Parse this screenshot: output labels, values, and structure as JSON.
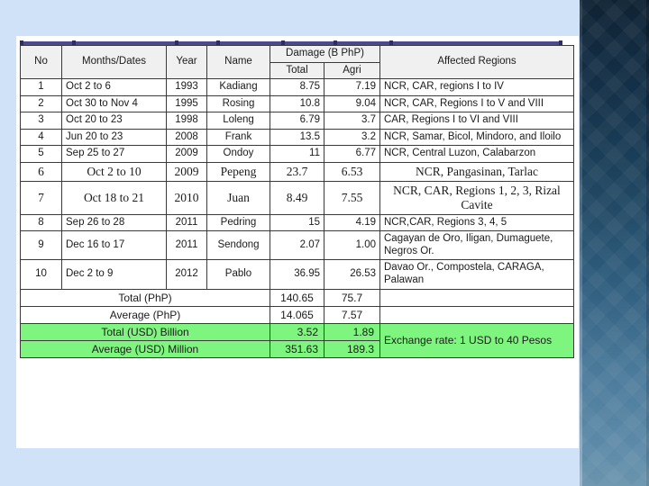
{
  "slide": {
    "background_color": "#cfe2f7",
    "panel_gradient_top": "#0f2233",
    "panel_gradient_bottom": "#6b94ad",
    "card_color": "#ffffff",
    "ruler_color": "#4a4a8c",
    "highlight_green": "#7ef57e"
  },
  "table": {
    "headers": {
      "no": "No",
      "months_dates": "Months/Dates",
      "year": "Year",
      "name": "Name",
      "damage_group": "Damage (B PhP)",
      "total": "Total",
      "agri": "Agri",
      "affected_regions": "Affected Regions"
    },
    "rows": [
      {
        "no": "1",
        "dates": "Oct 2 to 6",
        "year": "1993",
        "name": "Kadiang",
        "total": "8.75",
        "agri": "7.19",
        "regions": "NCR, CAR, regions I to IV",
        "style": "sans"
      },
      {
        "no": "2",
        "dates": "Oct 30 to Nov 4",
        "year": "1995",
        "name": "Rosing",
        "total": "10.8",
        "agri": "9.04",
        "regions": "NCR, CAR, Regions  I to V and VIII",
        "style": "sans"
      },
      {
        "no": "3",
        "dates": "Oct 20 to 23",
        "year": "1998",
        "name": "Loleng",
        "total": "6.79",
        "agri": "3.7",
        "regions": "CAR, Regions I to VI and VIII",
        "style": "sans"
      },
      {
        "no": "4",
        "dates": "Jun 20 to 23",
        "year": "2008",
        "name": "Frank",
        "total": "13.5",
        "agri": "3.2",
        "regions": "NCR, Samar, Bicol, Mindoro, and Iloilo",
        "style": "sans"
      },
      {
        "no": "5",
        "dates": "Sep 25 to 27",
        "year": "2009",
        "name": "Ondoy",
        "total": "11",
        "agri": "6.77",
        "regions": "NCR, Central Luzon, Calabarzon",
        "style": "sans"
      },
      {
        "no": "6",
        "dates": "Oct 2 to 10",
        "year": "2009",
        "name": "Pepeng",
        "total": "23.7",
        "agri": "6.53",
        "regions": "NCR, Pangasinan, Tarlac",
        "style": "serif"
      },
      {
        "no": "7",
        "dates": "Oct 18 to 21",
        "year": "2010",
        "name": "Juan",
        "total": "8.49",
        "agri": "7.55",
        "regions": "NCR, CAR, Regions 1, 2, 3, Rizal Cavite",
        "style": "serif"
      },
      {
        "no": "8",
        "dates": "Sep 26 to 28",
        "year": "2011",
        "name": "Pedring",
        "total": "15",
        "agri": "4.19",
        "regions": "NCR,CAR,  Regions 3, 4, 5",
        "style": "sans"
      },
      {
        "no": "9",
        "dates": "Dec 16 to 17",
        "year": "2011",
        "name": "Sendong",
        "total": "2.07",
        "agri": "1.00",
        "regions": "Cagayan de Oro, Iligan, Dumaguete, Negros Or.",
        "style": "sans"
      },
      {
        "no": "10",
        "dates": "Dec 2 to 9",
        "year": "2012",
        "name": "Pablo",
        "total": "36.95",
        "agri": "26.53",
        "regions": "Davao Or.,  Compostela, CARAGA, Palawan",
        "style": "sans"
      }
    ],
    "summary": [
      {
        "label": "Total (PhP)",
        "total": "140.65",
        "agri": "75.7",
        "green": false
      },
      {
        "label": "Average (PhP)",
        "total": "14.065",
        "agri": "7.57",
        "green": false
      },
      {
        "label": "Total (USD) Billion",
        "total": "3.52",
        "agri": "1.89",
        "green": true
      },
      {
        "label": "Average (USD) Million",
        "total": "351.63",
        "agri": "189.3",
        "green": true
      }
    ],
    "exchange_note": "Exchange rate:  1 USD to 40 Pesos"
  }
}
